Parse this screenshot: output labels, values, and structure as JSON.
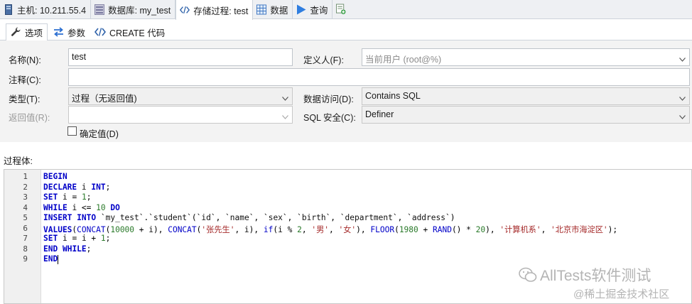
{
  "top_tabs": [
    {
      "label": "主机: 10.211.55.4",
      "icon": "server-icon"
    },
    {
      "label": "数据库: my_test",
      "icon": "database-icon"
    },
    {
      "label": "存储过程: test",
      "icon": "procedure-icon"
    },
    {
      "label": "数据",
      "icon": "grid-icon"
    },
    {
      "label": "查询",
      "icon": "play-icon"
    }
  ],
  "sub_tabs": [
    {
      "label": "选项",
      "icon": "wrench-icon"
    },
    {
      "label": "参数",
      "icon": "arrows-icon"
    },
    {
      "label": "CREATE 代码",
      "icon": "code-icon"
    }
  ],
  "form": {
    "name_label": "名称(N):",
    "name_value": "test",
    "definer_label": "定义人(F):",
    "definer_value": "当前用户 (root@%)",
    "comment_label": "注释(C):",
    "comment_value": "",
    "type_label": "类型(T):",
    "type_value": "过程（无返回值)",
    "data_access_label": "数据访问(D):",
    "data_access_value": "Contains SQL",
    "returns_label": "返回值(R):",
    "returns_value": "",
    "sql_security_label": "SQL 安全(C):",
    "sql_security_value": "Definer",
    "deterministic_label": "确定值(D)",
    "deterministic_checked": false
  },
  "body_label": "过程体:",
  "code_lines": [
    {
      "n": "1",
      "text": "BEGIN"
    },
    {
      "n": "2",
      "text": "DECLARE i INT;"
    },
    {
      "n": "3",
      "text": "SET i = 1;"
    },
    {
      "n": "4",
      "text": "WHILE i <= 10 DO"
    },
    {
      "n": "5",
      "text": "INSERT INTO `my_test`.`student`(`id`, `name`, `sex`, `birth`, `department`, `address`)"
    },
    {
      "n": "6",
      "text": "VALUES(CONCAT(10000 + i), CONCAT('张先生', i), if(i % 2, '男', '女'), FLOOR(1980 + RAND() * 20), '计算机系', '北京市海淀区');"
    },
    {
      "n": "7",
      "text": "SET i = i + 1;"
    },
    {
      "n": "8",
      "text": "END WHILE;"
    },
    {
      "n": "9",
      "text": "END"
    }
  ],
  "watermark": {
    "line1": "AllTests软件测试",
    "line2": "@稀土掘金技术社区"
  },
  "colors": {
    "keyword": "#0000c8",
    "string": "#a52a2a",
    "number": "#2a7a2a"
  }
}
